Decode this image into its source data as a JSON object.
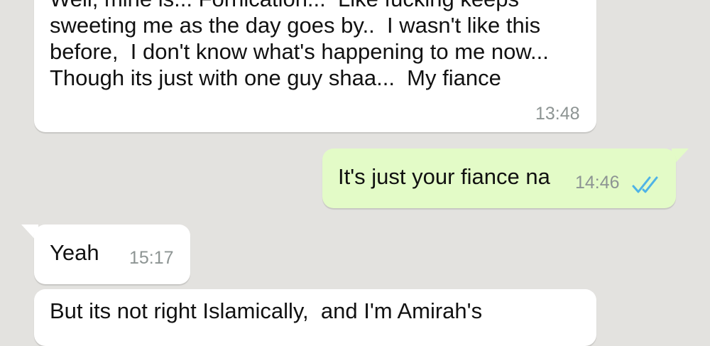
{
  "messages": [
    {
      "direction": "incoming",
      "lines": [
        "Well, mine is... Fornication...  Like fucking keeps",
        "sweeting me as the day goes by..  I wasn't like this",
        "before,  I don't know what's happening to me now...",
        "Though its just with one guy shaa...  My fiance"
      ],
      "time": "13:48"
    },
    {
      "direction": "outgoing",
      "text": "It's just your fiance na",
      "time": "14:46",
      "status_icon": "double-check-read-icon",
      "status_color": "#4fb3e6"
    },
    {
      "direction": "incoming",
      "text": "Yeah",
      "time": "15:17"
    },
    {
      "direction": "incoming",
      "text": "But its not right Islamically,  and I'm Amirah's"
    }
  ],
  "colors": {
    "background": "#e3e2df",
    "incoming_bubble": "#ffffff",
    "outgoing_bubble": "#e3fbc7",
    "timestamp": "#8d9493"
  }
}
